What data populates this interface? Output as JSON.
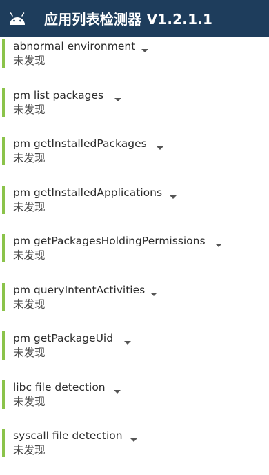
{
  "app": {
    "title": "应用列表检测器 V1.2.1.1"
  },
  "colors": {
    "appbar": "#1e3d5c",
    "accent_bar": "#8bc34a"
  },
  "icons": {
    "logo": "android-icon",
    "expand": "chevron-down-icon"
  },
  "items": [
    {
      "name": "abnormal environment",
      "status": "未发现"
    },
    {
      "name": "pm list packages",
      "status": "未发现"
    },
    {
      "name": "pm getInstalledPackages",
      "status": "未发现"
    },
    {
      "name": "pm getInstalledApplications",
      "status": "未发现"
    },
    {
      "name": "pm getPackagesHoldingPermissions",
      "status": "未发现"
    },
    {
      "name": "pm queryIntentActivities",
      "status": "未发现"
    },
    {
      "name": "pm getPackageUid",
      "status": "未发现"
    },
    {
      "name": "libc file detection",
      "status": "未发现"
    },
    {
      "name": "syscall file detection",
      "status": "未发现"
    }
  ]
}
